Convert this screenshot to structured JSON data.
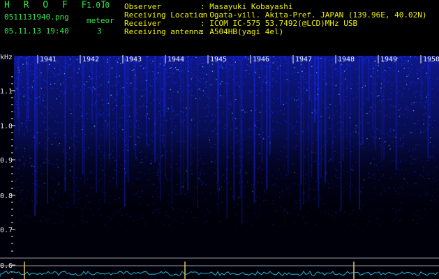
{
  "header": {
    "app_title": "H R O F F T",
    "version": "1.0.0",
    "file_name": "0511131940.png",
    "datetime": "05.11.13 19:40",
    "meteor_label": "meteor",
    "meteor_count": "3"
  },
  "info": [
    {
      "label": "Observer",
      "value": ": Masayuki Kobayashi"
    },
    {
      "label": "Receiving Location",
      "value": ": Ogata-vill. Akita-Pref. JAPAN (139.96E, 40.02N)"
    },
    {
      "label": "Receiver",
      "value": ": ICOM IC-575 53.7492(@LCD)MHz USB"
    },
    {
      "label": "Receiving antenna",
      "value": ": A504HB(yagi 4el)"
    }
  ],
  "spectrogram": {
    "unit_label": "kHz",
    "freq_ticks": [
      "1.1",
      "1.0",
      "0.9",
      "0.8",
      "0.7",
      "0.6"
    ],
    "time_labels": [
      "1941",
      "1942",
      "1943",
      "1944",
      "1945",
      "1946",
      "1947",
      "1948",
      "1949",
      "1950"
    ],
    "colors": {
      "noise": "#1b2cff",
      "bright": "#39d8ff",
      "baseline": "#1bbbd8",
      "marker": "#e8c35a",
      "text": "#2fe84a",
      "info": "#f0f000"
    }
  }
}
